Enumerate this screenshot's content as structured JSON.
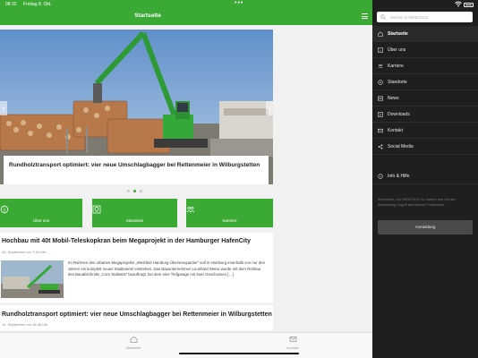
{
  "status_bar": {
    "time": "08:32",
    "date": "Freitag 8. Okt."
  },
  "header": {
    "title": "Startseite"
  },
  "hero": {
    "caption": "Rundholztransport optimiert: vier neue Umschlagbagger bei Rettenmeier in Wilburgstetten",
    "page_count": 3,
    "active_page": 2
  },
  "quick_links": [
    {
      "label": "Über uns",
      "icon": "info-icon"
    },
    {
      "label": "Standorte",
      "icon": "location-icon"
    },
    {
      "label": "Karriere",
      "icon": "people-icon"
    }
  ],
  "articles": [
    {
      "title": "Hochbau mit 40t Mobil-Teleskopkran beim Megaprojekt in der Hamburger HafenCity",
      "date": "28. September um 7:43 Uhr",
      "excerpt": "Im Rahmen des urbanen Megaprojekts „Westfeld Hamburg-Überseequartier“ soll in Hamburg innerhalb von nur drei Jahren ein komplett neues Stadtviertel entstehen. Das Bauunternehmen Leonhard Weiss wurde mit dem Rohbau des Bauabschnitts „Core Südwest“ beauftragt, bei dem eine Tiefgarage mit zwei Geschossen […]"
    },
    {
      "title": "Rundholztransport optimiert: vier neue Umschlagbagger bei Rettenmeier in Wilburgstetten",
      "date": "14. September um 16:48 Uhr"
    }
  ],
  "tabbar": {
    "items": [
      {
        "label": "Startseite",
        "icon": "home-icon"
      },
      {
        "label": "Kontakt",
        "icon": "mail-icon"
      }
    ]
  },
  "side_menu": {
    "search_placeholder": "Suchen in SENCOCO",
    "items": [
      {
        "label": "Startseite",
        "icon": "home-icon",
        "active": true
      },
      {
        "label": "Über uns",
        "icon": "info-icon",
        "active": false
      },
      {
        "label": "Karriere",
        "icon": "people-icon",
        "active": false
      },
      {
        "label": "Standorte",
        "icon": "location-icon",
        "active": false
      },
      {
        "label": "News",
        "icon": "news-icon",
        "active": false
      },
      {
        "label": "Downloads",
        "icon": "download-icon",
        "active": false
      },
      {
        "label": "Kontakt",
        "icon": "mail-icon",
        "active": false
      },
      {
        "label": "Social Media",
        "icon": "social-icon",
        "active": false
      },
      {
        "label": "Info & Hilfe",
        "icon": "help-icon",
        "active": false
      }
    ],
    "login_note": "Anmelden, um SENCOCO zu nutzen und bei der Anmeldung Zugriff auf weitere Funktionen.",
    "login_button": "Anmeldung"
  },
  "colors": {
    "brand_green": "#3aaa35",
    "menu_bg": "#1f1f1f",
    "content_bg": "#f1f1f1"
  }
}
